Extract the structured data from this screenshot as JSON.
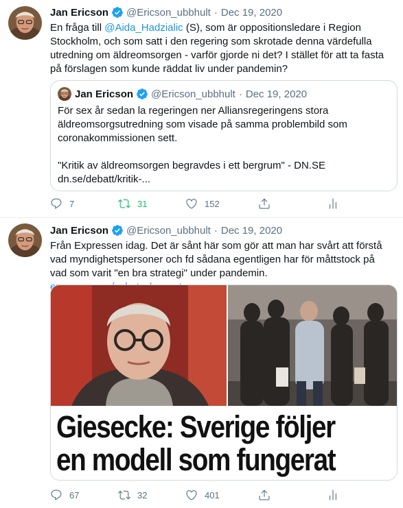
{
  "tweets": [
    {
      "author_name": "Jan Ericson",
      "handle": "@Ericson_ubbhult",
      "separator": "·",
      "date": "Dec 19, 2020",
      "text_before_mention": "En fråga till ",
      "mention": "@Aida_Hadzialic",
      "text_after_mention": " (S), som är oppositionsledare i Region Stockholm, och som satt i den regering som skrotade denna värdefulla utredning om äldreomsorgen - varför gjorde ni det? I stället för att ta fasta på förslagen som kunde räddat liv under pandemin?",
      "quote": {
        "author_name": "Jan Ericson",
        "handle": "@Ericson_ubbhult",
        "separator": "·",
        "date": "Dec 19, 2020",
        "paragraph1": "För sex år sedan la regeringen ner Alliansregeringens stora äldreomsorgsutredning som visade på samma problembild som coronakommissionen sett.",
        "paragraph2_line1": "\"Kritik av äldreomsorgen begravdes i ett bergrum\" - DN.SE",
        "paragraph2_line2": "dn.se/debatt/kritik-..."
      },
      "actions": {
        "replies": "7",
        "retweets": "31",
        "likes": "152"
      }
    },
    {
      "author_name": "Jan Ericson",
      "handle": "@Ericson_ubbhult",
      "separator": "·",
      "date": "Dec 19, 2020",
      "text": "Från Expressen idag. Det är sånt här som gör att man har svårt att förstå vad myndighetspersoner och fd sådana egentligen har för måttstock på vad som varit \"en bra strategi\" under pandemin. ",
      "link": "expressen.se/nyheter/senast...",
      "media_headline_line1": "Giesecke: Sverige följer",
      "media_headline_line2": "en modell som fungerat",
      "actions": {
        "replies": "67",
        "retweets": "32",
        "likes": "401"
      }
    }
  ],
  "colors": {
    "accent": "#1b95e0",
    "muted": "#5b7083",
    "retweet_active": "#17bf63",
    "verified": "#1da1f2",
    "divider": "#ebeef0"
  },
  "icons": [
    "verified-badge-icon",
    "reply-icon",
    "retweet-icon",
    "like-icon",
    "share-icon",
    "analytics-icon"
  ]
}
